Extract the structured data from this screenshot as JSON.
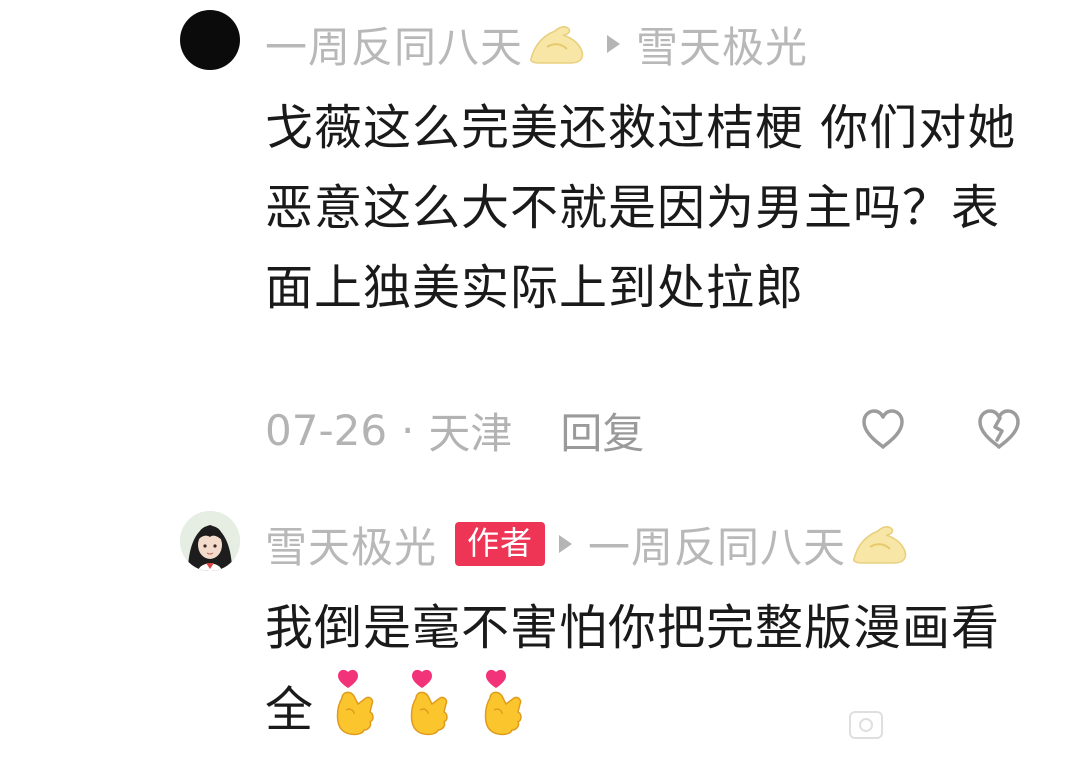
{
  "comments": [
    {
      "username": "一周反同八天",
      "username_emoji": "💪",
      "reply_to": "雪天极光",
      "text": "戈薇这么完美还救过桔梗 你们对她恶意这么大不就是因为男主吗？表面上独美实际上到处拉郎",
      "date": "07-26",
      "separator": "·",
      "location": "天津",
      "reply_label": "回复",
      "icons": {
        "avatar": "avatar-black-circle",
        "arrow": "right-triangle-icon",
        "like": "heart-outline-icon",
        "dislike": "broken-heart-outline-icon"
      }
    },
    {
      "username": "雪天极光",
      "badge": "作者",
      "reply_to": "一周反同八天",
      "reply_to_emoji": "💪",
      "text": "我倒是毫不害怕你把完整版漫画看全",
      "trailing_emojis": [
        "🫰",
        "🫰",
        "🫰"
      ],
      "icons": {
        "avatar": "avatar-anime-girl",
        "arrow": "right-triangle-icon",
        "trailing": "finger-heart-emoji"
      }
    }
  ],
  "colors": {
    "username": "#b8b8b8",
    "body_text": "#1a1a1a",
    "meta": "#b3b3b3",
    "author_badge_bg": "#ee3556",
    "author_badge_text": "#ffffff"
  }
}
